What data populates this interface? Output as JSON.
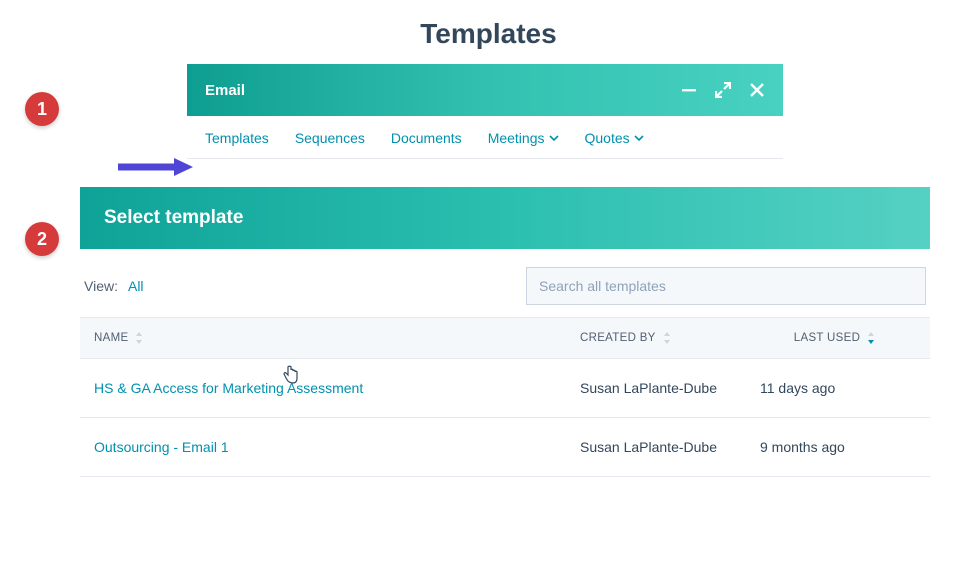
{
  "page": {
    "title": "Templates"
  },
  "steps": {
    "one": "1",
    "two": "2"
  },
  "email_bar": {
    "title": "Email"
  },
  "tabs": {
    "templates": "Templates",
    "sequences": "Sequences",
    "documents": "Documents",
    "meetings": "Meetings",
    "quotes": "Quotes"
  },
  "panel": {
    "header": "Select template"
  },
  "filter": {
    "view_label": "View:",
    "view_value": "All",
    "search_placeholder": "Search all templates"
  },
  "columns": {
    "name": "NAME",
    "created_by": "CREATED BY",
    "last_used": "LAST USED"
  },
  "rows": [
    {
      "name": "HS & GA Access for Marketing Assessment",
      "created_by": "Susan LaPlante-Dube",
      "last_used": "11 days ago"
    },
    {
      "name": "Outsourcing - Email 1",
      "created_by": "Susan LaPlante-Dube",
      "last_used": "9 months ago"
    }
  ]
}
